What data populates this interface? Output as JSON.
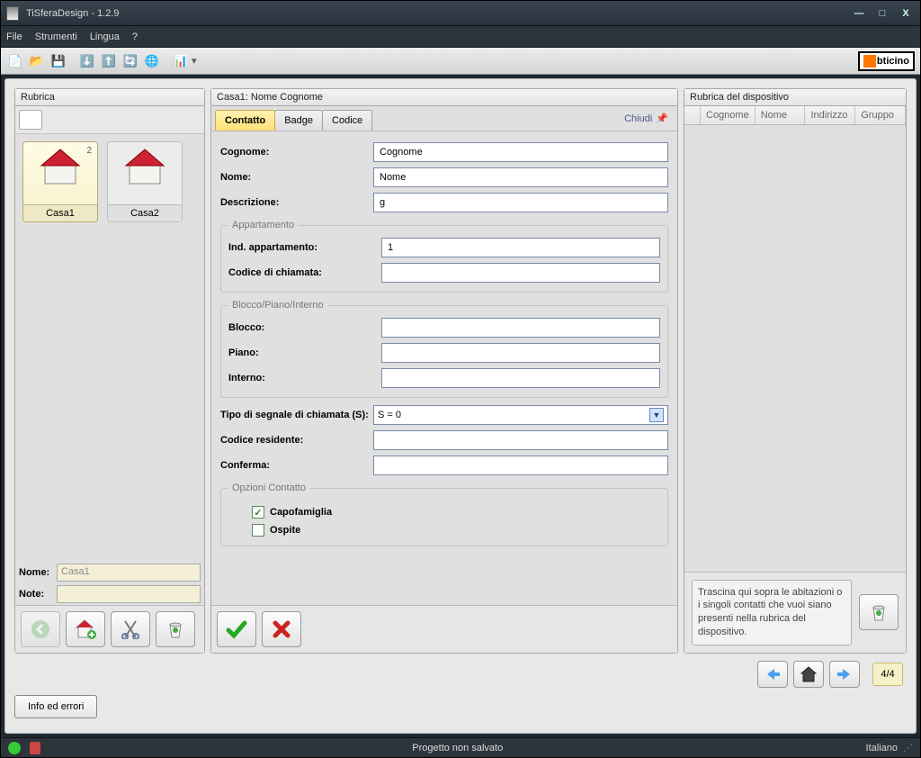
{
  "window": {
    "title": "TiSferaDesign - 1.2.9"
  },
  "menu": {
    "file": "File",
    "strumenti": "Strumenti",
    "lingua": "Lingua",
    "help": "?"
  },
  "brand": "ticino",
  "left": {
    "header": "Rubrica",
    "houses": [
      {
        "label": "Casa1",
        "badge": "2",
        "selected": true
      },
      {
        "label": "Casa2",
        "badge": "",
        "selected": false
      }
    ],
    "nome_label": "Nome:",
    "nome_value": "Casa1",
    "note_label": "Note:",
    "note_value": ""
  },
  "mid": {
    "header": "Casa1: Nome Cognome",
    "tabs": {
      "contatto": "Contatto",
      "badge": "Badge",
      "codice": "Codice"
    },
    "close": "Chiudi",
    "fields": {
      "cognome_label": "Cognome:",
      "cognome": "Cognome",
      "nome_label": "Nome:",
      "nome": "Nome",
      "descr_label": "Descrizione:",
      "descr": "g",
      "group_appart": "Appartamento",
      "indapp_label": "Ind. appartamento:",
      "indapp": "1",
      "codchiam_label": "Codice di chiamata:",
      "codchiam": "",
      "group_bpi": "Blocco/Piano/Interno",
      "blocco_label": "Blocco:",
      "blocco": "",
      "piano_label": "Piano:",
      "piano": "",
      "interno_label": "Interno:",
      "interno": "",
      "tipo_label": "Tipo di segnale di chiamata (S):",
      "tipo_value": "S = 0",
      "codres_label": "Codice residente:",
      "codres": "",
      "conf_label": "Conferma:",
      "conf": "",
      "group_opz": "Opzioni Contatto",
      "capofamiglia": "Capofamiglia",
      "ospite": "Ospite"
    }
  },
  "right": {
    "header": "Rubrica del dispositivo",
    "cols": {
      "cognome": "Cognome",
      "nome": "Nome",
      "indirizzo": "Indirizzo",
      "gruppo": "Gruppo"
    },
    "hint": "Trascina qui sopra le abitazioni o i singoli contatti che vuoi siano presenti nella rubrica del dispositivo."
  },
  "nav": {
    "page": "4/4"
  },
  "info_btn": "Info ed errori",
  "status": {
    "center": "Progetto non salvato",
    "lang": "Italiano"
  }
}
